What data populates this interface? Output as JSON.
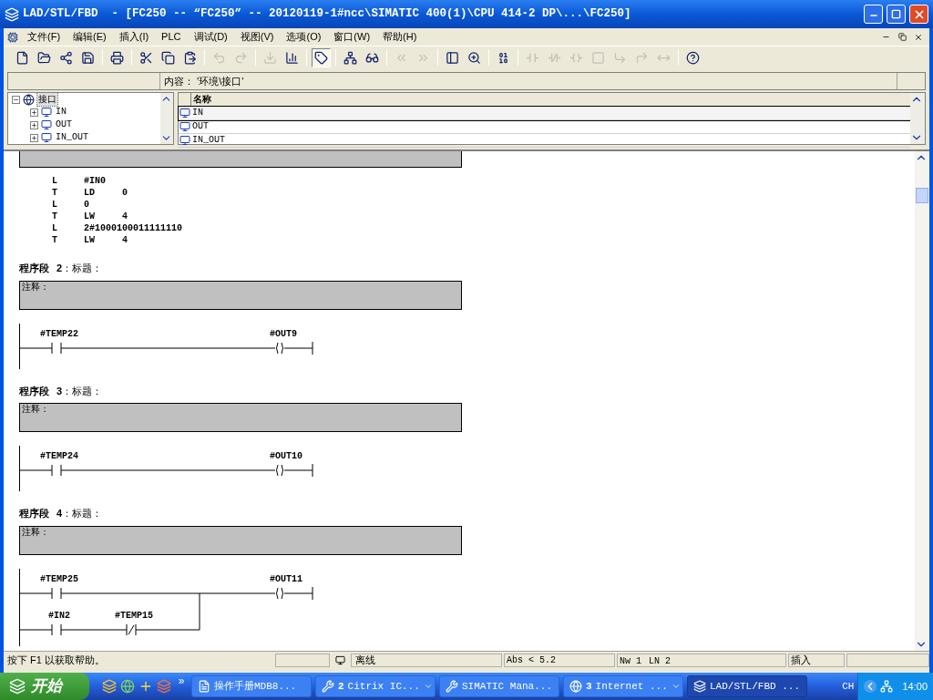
{
  "window": {
    "title": "LAD/STL/FBD  - [FC250 -- “FC250” -- 20120119-1#ncc\\SIMATIC 400(1)\\CPU 414-2 DP\\...\\FC250]"
  },
  "menu": [
    "文件(F)",
    "编辑(E)",
    "插入(I)",
    "PLC",
    "调试(D)",
    "视图(V)",
    "选项(O)",
    "窗口(W)",
    "帮助(H)"
  ],
  "toolbar": [
    {
      "disabled": false,
      "pressed": false
    },
    {
      "disabled": false,
      "pressed": false
    },
    {
      "disabled": false,
      "pressed": false
    },
    {
      "disabled": false,
      "pressed": false
    },
    {
      "disabled": false,
      "pressed": false
    },
    {
      "disabled": false,
      "pressed": false
    },
    {
      "disabled": false,
      "pressed": false
    },
    {
      "disabled": false,
      "pressed": false
    },
    {
      "disabled": true,
      "pressed": false
    },
    {
      "disabled": true,
      "pressed": false
    },
    {
      "disabled": true,
      "pressed": false
    },
    {
      "disabled": false,
      "pressed": false
    },
    {
      "disabled": false,
      "pressed": true
    },
    {
      "disabled": false,
      "pressed": false
    },
    {
      "disabled": false,
      "pressed": false
    },
    {
      "disabled": true,
      "pressed": false
    },
    {
      "disabled": true,
      "pressed": false
    },
    {
      "disabled": false,
      "pressed": false
    },
    {
      "disabled": false,
      "pressed": false
    },
    {
      "disabled": false,
      "pressed": false
    },
    {
      "disabled": true,
      "pressed": false
    },
    {
      "disabled": true,
      "pressed": false
    },
    {
      "disabled": true,
      "pressed": false
    },
    {
      "disabled": true,
      "pressed": false
    },
    {
      "disabled": true,
      "pressed": false
    },
    {
      "disabled": true,
      "pressed": false
    },
    {
      "disabled": true,
      "pressed": false
    },
    {
      "disabled": false,
      "pressed": false
    }
  ],
  "content_path": "内容： '环境\\接口'",
  "tree": {
    "label": "接口",
    "expanded": true,
    "selected": true,
    "children": [
      {
        "label": "IN",
        "expanded": false,
        "selected": false
      },
      {
        "label": "OUT",
        "expanded": false,
        "selected": false
      },
      {
        "label": "IN_OUT",
        "expanded": false,
        "selected": false
      }
    ]
  },
  "interface_table": {
    "column": "名称",
    "rows": [
      {
        "name": "IN",
        "selected": true
      },
      {
        "name": "OUT",
        "selected": false
      },
      {
        "name": "IN_OUT",
        "selected": false
      }
    ]
  },
  "networks": [
    {
      "kind": "stl",
      "lines": [
        {
          "op": "L",
          "operand": "#IN0"
        },
        {
          "op": "T",
          "operand": "LD",
          "value": "0"
        },
        {
          "op": "L",
          "operand": "0"
        },
        {
          "op": "T",
          "operand": "LW",
          "value": "4"
        },
        {
          "op": "L",
          "operand": "2#1000100011111110"
        },
        {
          "op": "T",
          "operand": "LW",
          "value": "4"
        }
      ]
    },
    {
      "kind": "ladder",
      "label": "程序段",
      "number": "2",
      "title": "：标题：",
      "comment": "注释：",
      "contacts": [
        {
          "label": "#TEMP22",
          "kind": "no"
        }
      ],
      "coil": "#OUT9"
    },
    {
      "kind": "ladder",
      "label": "程序段",
      "number": "3",
      "title": "：标题：",
      "comment": "注释：",
      "contacts": [
        {
          "label": "#TEMP24",
          "kind": "no"
        }
      ],
      "coil": "#OUT10"
    },
    {
      "kind": "ladder",
      "label": "程序段",
      "number": "4",
      "title": "：标题：",
      "comment": "注释：",
      "contacts": [
        {
          "label": "#TEMP25",
          "kind": "no"
        }
      ],
      "branch": [
        {
          "label": "#IN2",
          "kind": "no"
        },
        {
          "label": "#TEMP15",
          "kind": "nc"
        }
      ],
      "coil": "#OUT11"
    }
  ],
  "status_bar": {
    "help": "按下 F1 以获取帮助。",
    "connection": "离线",
    "address": "Abs < 5.2",
    "network": "Nw 1",
    "line": "LN 2",
    "mode": "插入"
  },
  "taskbar": {
    "start": "开始",
    "more": "»",
    "tasks": [
      {
        "label": "操作手册MDB8...",
        "dropdown": false,
        "selected": false
      },
      {
        "count": "2",
        "label": "Citrix IC...",
        "dropdown": true,
        "selected": false
      },
      {
        "label": "SIMATIC Mana...",
        "dropdown": false,
        "selected": false
      },
      {
        "count": "3",
        "label": "Internet ...",
        "dropdown": true,
        "selected": false
      },
      {
        "label": "LAD/STL/FBD ...",
        "dropdown": false,
        "selected": true
      }
    ],
    "language": "CH",
    "time": "14:00"
  }
}
